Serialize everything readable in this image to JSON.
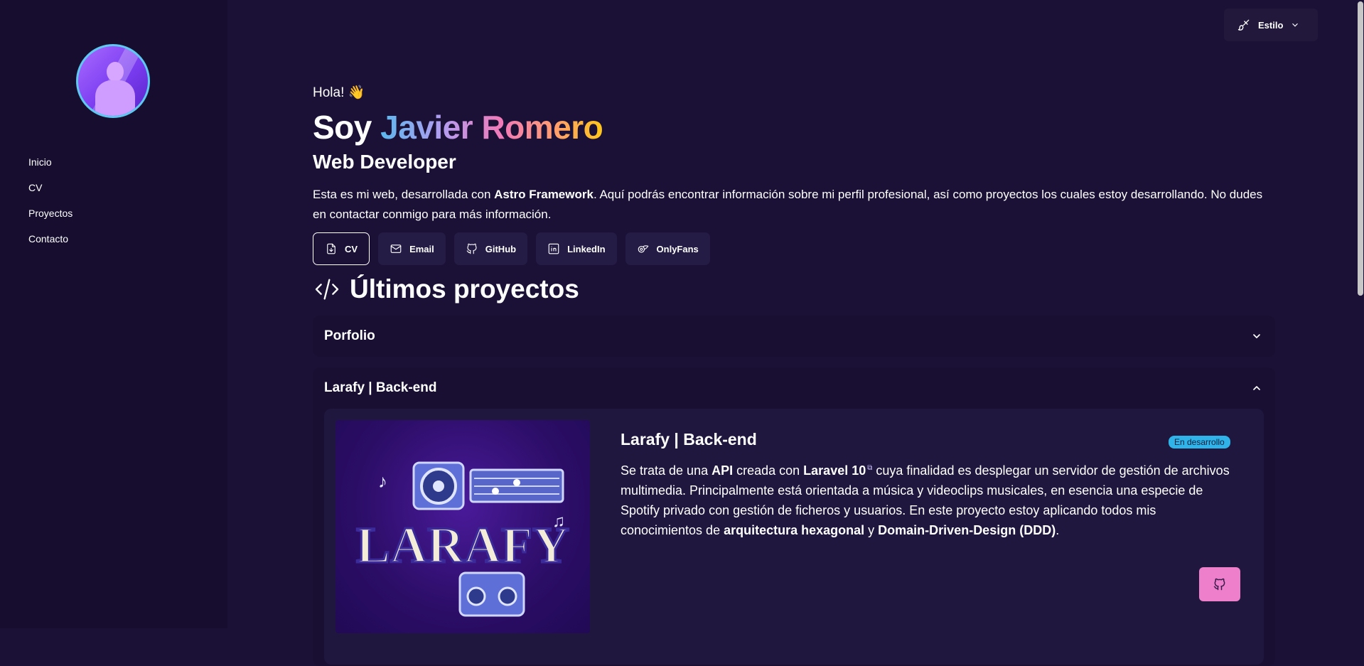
{
  "sidebar": {
    "nav": [
      "Inicio",
      "CV",
      "Proyectos",
      "Contacto"
    ]
  },
  "header": {
    "style_label": "Estilo"
  },
  "hero": {
    "greeting": "Hola! 👋",
    "prefix": "Soy",
    "name": "Javier Romero",
    "role": "Web Developer",
    "intro_before": "Esta es mi web, desarrollada con ",
    "intro_bold": "Astro Framework",
    "intro_after": ". Aquí podrás encontrar información sobre mi perfil profesional, así como proyectos los cuales estoy desarrollando. No dudes en contactar conmigo para más información."
  },
  "links": [
    {
      "label": "CV",
      "icon": "download-file-icon"
    },
    {
      "label": "Email",
      "icon": "mail-icon"
    },
    {
      "label": "GitHub",
      "icon": "github-icon"
    },
    {
      "label": "LinkedIn",
      "icon": "linkedin-icon"
    },
    {
      "label": "OnlyFans",
      "icon": "onlyfans-icon"
    }
  ],
  "projects": {
    "title": "Últimos proyectos",
    "items": [
      {
        "title": "Porfolio",
        "expanded": false
      },
      {
        "title": "Larafy | Back-end",
        "expanded": true,
        "card_title": "Larafy | Back-end",
        "status": "En desarrollo",
        "image_text": "LARAFY",
        "desc": {
          "p1": "Se trata de una ",
          "b1": "API",
          "p2": " creada con ",
          "b2": "Laravel 10",
          "p3": " cuya finalidad es desplegar un servidor de gestión de archivos multimedia. Principalmente está orientada a música y videoclips musicales, en esencia una especie de Spotify privado con gestión de ficheros y usuarios. En este proyecto estoy aplicando todos mis conocimientos de ",
          "b3": "arquitectura hexagonal",
          "p4": " y ",
          "b4": "Domain-Driven-Design (DDD)",
          "p5": "."
        }
      }
    ]
  },
  "colors": {
    "background": "#1b1136",
    "sidebar": "#170e2f",
    "badge": "#2fb3e8",
    "github_button": "#ee7fcb"
  }
}
